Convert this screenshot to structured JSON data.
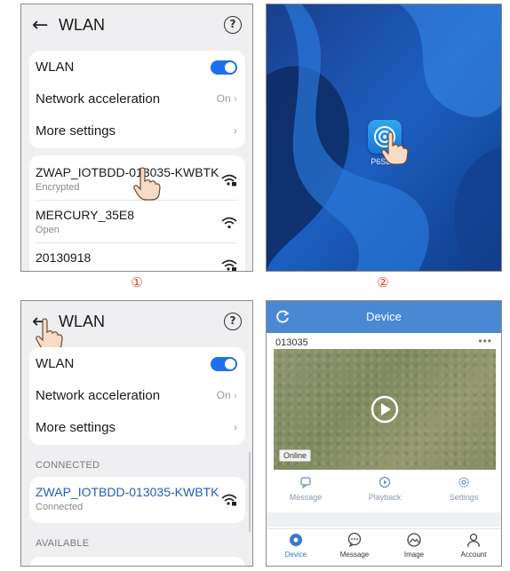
{
  "step_labels": [
    "①",
    "②"
  ],
  "wlan_screen": {
    "title": "WLAN",
    "wlan_label": "WLAN",
    "network_acceleration_label": "Network acceleration",
    "network_acceleration_value": "On",
    "more_settings_label": "More settings"
  },
  "wlan_list": [
    {
      "ssid": "ZWAP_IOTBDD-013035-KWBTK",
      "status": "Encrypted",
      "locked": true
    },
    {
      "ssid": "MERCURY_35E8",
      "status": "Open",
      "locked": false
    },
    {
      "ssid": "20130918",
      "status": "",
      "locked": true
    }
  ],
  "connected_section": {
    "header": "CONNECTED",
    "ssid": "ZWAP_IOTBDD-013035-KWBTK",
    "status": "Connected"
  },
  "available_section": {
    "header": "AVAILABLE"
  },
  "desktop": {
    "app_label": "P6SLite"
  },
  "device_app": {
    "title": "Device",
    "device_name": "013035",
    "more": "•••",
    "status_badge": "Online",
    "actions": [
      "Message",
      "Playback",
      "Settings"
    ],
    "tabs": [
      "Device",
      "Message",
      "Image",
      "Account"
    ],
    "active_tab": "Device"
  },
  "colors": {
    "accent_blue": "#1e6ff0",
    "app_bar": "#4a88d4",
    "connected_ssid": "#1f5fbf",
    "step_number": "#d04a2a"
  }
}
